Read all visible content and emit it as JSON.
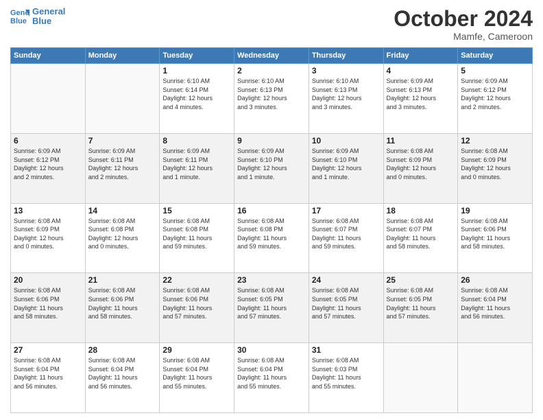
{
  "logo": {
    "line1": "General",
    "line2": "Blue"
  },
  "title": "October 2024",
  "location": "Mamfe, Cameroon",
  "weekdays": [
    "Sunday",
    "Monday",
    "Tuesday",
    "Wednesday",
    "Thursday",
    "Friday",
    "Saturday"
  ],
  "weeks": [
    [
      {
        "day": "",
        "info": ""
      },
      {
        "day": "",
        "info": ""
      },
      {
        "day": "1",
        "info": "Sunrise: 6:10 AM\nSunset: 6:14 PM\nDaylight: 12 hours\nand 4 minutes."
      },
      {
        "day": "2",
        "info": "Sunrise: 6:10 AM\nSunset: 6:13 PM\nDaylight: 12 hours\nand 3 minutes."
      },
      {
        "day": "3",
        "info": "Sunrise: 6:10 AM\nSunset: 6:13 PM\nDaylight: 12 hours\nand 3 minutes."
      },
      {
        "day": "4",
        "info": "Sunrise: 6:09 AM\nSunset: 6:13 PM\nDaylight: 12 hours\nand 3 minutes."
      },
      {
        "day": "5",
        "info": "Sunrise: 6:09 AM\nSunset: 6:12 PM\nDaylight: 12 hours\nand 2 minutes."
      }
    ],
    [
      {
        "day": "6",
        "info": "Sunrise: 6:09 AM\nSunset: 6:12 PM\nDaylight: 12 hours\nand 2 minutes."
      },
      {
        "day": "7",
        "info": "Sunrise: 6:09 AM\nSunset: 6:11 PM\nDaylight: 12 hours\nand 2 minutes."
      },
      {
        "day": "8",
        "info": "Sunrise: 6:09 AM\nSunset: 6:11 PM\nDaylight: 12 hours\nand 1 minute."
      },
      {
        "day": "9",
        "info": "Sunrise: 6:09 AM\nSunset: 6:10 PM\nDaylight: 12 hours\nand 1 minute."
      },
      {
        "day": "10",
        "info": "Sunrise: 6:09 AM\nSunset: 6:10 PM\nDaylight: 12 hours\nand 1 minute."
      },
      {
        "day": "11",
        "info": "Sunrise: 6:08 AM\nSunset: 6:09 PM\nDaylight: 12 hours\nand 0 minutes."
      },
      {
        "day": "12",
        "info": "Sunrise: 6:08 AM\nSunset: 6:09 PM\nDaylight: 12 hours\nand 0 minutes."
      }
    ],
    [
      {
        "day": "13",
        "info": "Sunrise: 6:08 AM\nSunset: 6:09 PM\nDaylight: 12 hours\nand 0 minutes."
      },
      {
        "day": "14",
        "info": "Sunrise: 6:08 AM\nSunset: 6:08 PM\nDaylight: 12 hours\nand 0 minutes."
      },
      {
        "day": "15",
        "info": "Sunrise: 6:08 AM\nSunset: 6:08 PM\nDaylight: 11 hours\nand 59 minutes."
      },
      {
        "day": "16",
        "info": "Sunrise: 6:08 AM\nSunset: 6:08 PM\nDaylight: 11 hours\nand 59 minutes."
      },
      {
        "day": "17",
        "info": "Sunrise: 6:08 AM\nSunset: 6:07 PM\nDaylight: 11 hours\nand 59 minutes."
      },
      {
        "day": "18",
        "info": "Sunrise: 6:08 AM\nSunset: 6:07 PM\nDaylight: 11 hours\nand 58 minutes."
      },
      {
        "day": "19",
        "info": "Sunrise: 6:08 AM\nSunset: 6:06 PM\nDaylight: 11 hours\nand 58 minutes."
      }
    ],
    [
      {
        "day": "20",
        "info": "Sunrise: 6:08 AM\nSunset: 6:06 PM\nDaylight: 11 hours\nand 58 minutes."
      },
      {
        "day": "21",
        "info": "Sunrise: 6:08 AM\nSunset: 6:06 PM\nDaylight: 11 hours\nand 58 minutes."
      },
      {
        "day": "22",
        "info": "Sunrise: 6:08 AM\nSunset: 6:06 PM\nDaylight: 11 hours\nand 57 minutes."
      },
      {
        "day": "23",
        "info": "Sunrise: 6:08 AM\nSunset: 6:05 PM\nDaylight: 11 hours\nand 57 minutes."
      },
      {
        "day": "24",
        "info": "Sunrise: 6:08 AM\nSunset: 6:05 PM\nDaylight: 11 hours\nand 57 minutes."
      },
      {
        "day": "25",
        "info": "Sunrise: 6:08 AM\nSunset: 6:05 PM\nDaylight: 11 hours\nand 57 minutes."
      },
      {
        "day": "26",
        "info": "Sunrise: 6:08 AM\nSunset: 6:04 PM\nDaylight: 11 hours\nand 56 minutes."
      }
    ],
    [
      {
        "day": "27",
        "info": "Sunrise: 6:08 AM\nSunset: 6:04 PM\nDaylight: 11 hours\nand 56 minutes."
      },
      {
        "day": "28",
        "info": "Sunrise: 6:08 AM\nSunset: 6:04 PM\nDaylight: 11 hours\nand 56 minutes."
      },
      {
        "day": "29",
        "info": "Sunrise: 6:08 AM\nSunset: 6:04 PM\nDaylight: 11 hours\nand 55 minutes."
      },
      {
        "day": "30",
        "info": "Sunrise: 6:08 AM\nSunset: 6:04 PM\nDaylight: 11 hours\nand 55 minutes."
      },
      {
        "day": "31",
        "info": "Sunrise: 6:08 AM\nSunset: 6:03 PM\nDaylight: 11 hours\nand 55 minutes."
      },
      {
        "day": "",
        "info": ""
      },
      {
        "day": "",
        "info": ""
      }
    ]
  ]
}
